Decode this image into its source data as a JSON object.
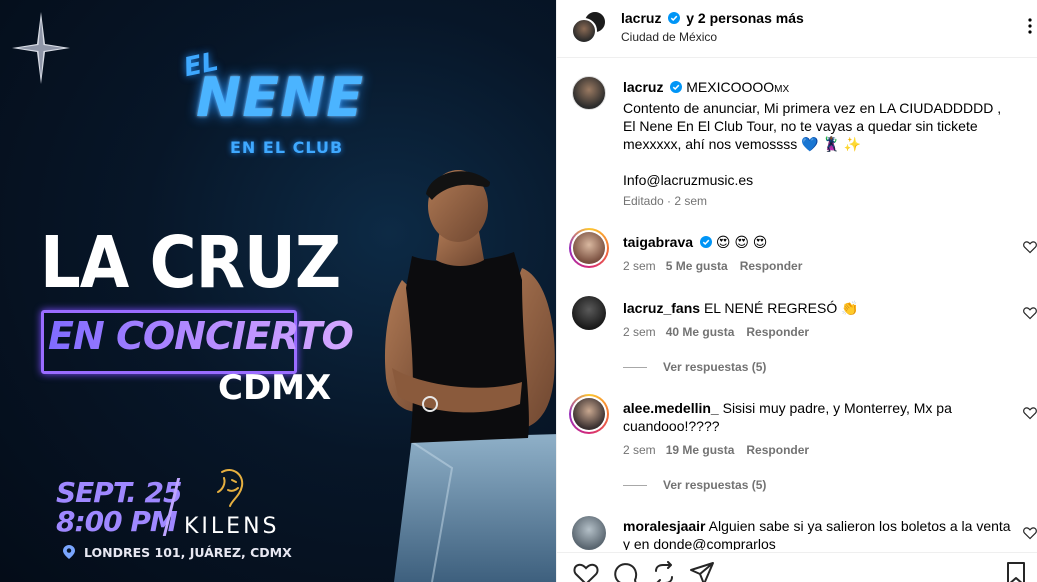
{
  "poster": {
    "logo_el": "EL",
    "logo_nene": "NENE",
    "logo_club": "EN EL CLUB",
    "artist": "LA CRUZ",
    "subtitle": "EN CONCIERTO",
    "city": "CDMX",
    "date": "SEPT. 25",
    "time": "8:00 PM",
    "venue": "KILENS",
    "address": "LONDRES 101, JUÁREZ, CDMX"
  },
  "header": {
    "username": "lacruz",
    "extra": "y 2 personas más",
    "location": "Ciudad de México"
  },
  "caption": {
    "username": "lacruz",
    "first_line": "MEXICOOOO",
    "first_line_small": "MX",
    "body": "Contento de anunciar, Mi primera vez en LA CIUDADDDDD , El Nene En El Club Tour, no te vayas a quedar sin tickete mexxxxx, ahí nos vemossss 💙 🦹🏾 ✨",
    "email": "Info@lacruzmusic.es",
    "meta": "Editado · 2 sem"
  },
  "comments": [
    {
      "username": "taigabrava",
      "verified": true,
      "text": "😍 😍 😍",
      "time": "2 sem",
      "likes": "5 Me gusta",
      "reply": "Responder"
    },
    {
      "username": "lacruz_fans",
      "verified": false,
      "text": "EL NENÉ REGRESÓ 👏",
      "time": "2 sem",
      "likes": "40 Me gusta",
      "reply": "Responder",
      "view_replies": "Ver respuestas (5)"
    },
    {
      "username": "alee.medellin_",
      "verified": false,
      "text": "Sisisi muy padre, y Monterrey, Mx pa cuandooo!????",
      "time": "2 sem",
      "likes": "19 Me gusta",
      "reply": "Responder",
      "view_replies": "Ver respuestas (5)"
    },
    {
      "username": "moralesjaair",
      "verified": false,
      "text": "Alguien sabe si ya salieron los boletos a la venta y en donde@comprarlos"
    }
  ],
  "colors": {
    "accent_blue": "#0095f6",
    "poster_blue": "#4bb4ff",
    "poster_purple": "#9f88ff",
    "meta_gray": "#737373"
  },
  "icons": [
    "star-icon",
    "verified-icon",
    "more-icon",
    "heart-icon",
    "comment-icon",
    "share-icon",
    "send-icon",
    "save-icon",
    "location-pin-icon"
  ]
}
